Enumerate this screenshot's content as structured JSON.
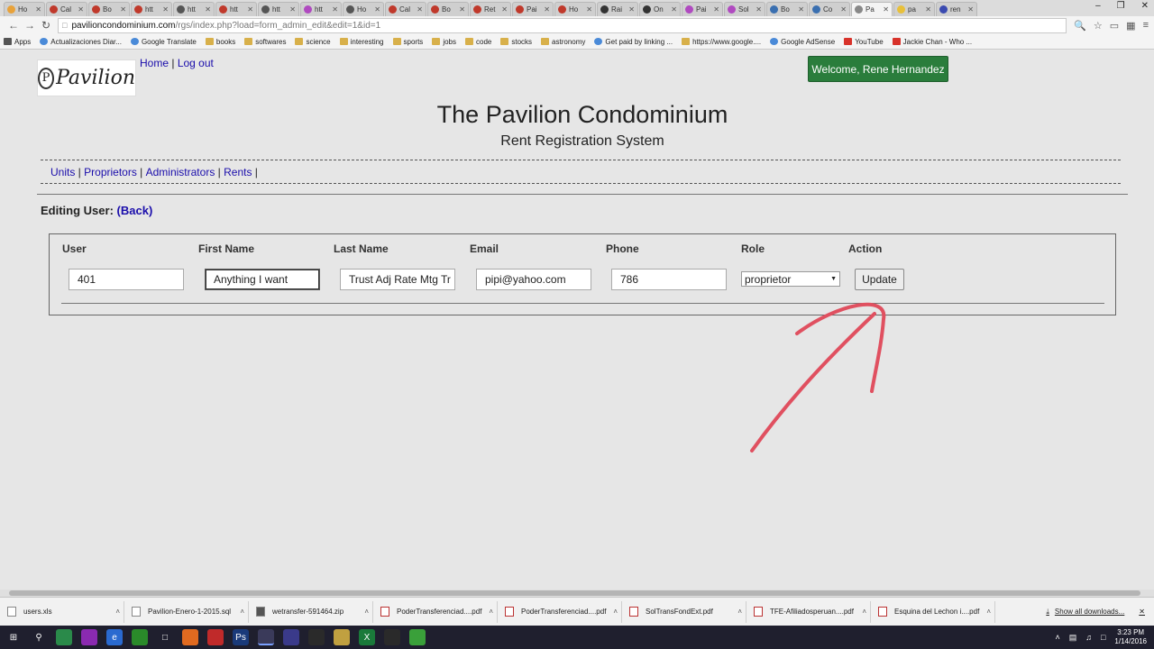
{
  "browser": {
    "tabs": [
      {
        "label": "Ho",
        "color": "#e8a23a"
      },
      {
        "label": "Cal",
        "color": "#c0392b"
      },
      {
        "label": "Bo",
        "color": "#c0392b"
      },
      {
        "label": "htt",
        "color": "#c0392b"
      },
      {
        "label": "htt",
        "color": "#555"
      },
      {
        "label": "htt",
        "color": "#c0392b"
      },
      {
        "label": "htt",
        "color": "#555"
      },
      {
        "label": "htt",
        "color": "#b04ac0"
      },
      {
        "label": "Ho",
        "color": "#555"
      },
      {
        "label": "Cal",
        "color": "#c0392b"
      },
      {
        "label": "Bo",
        "color": "#c0392b"
      },
      {
        "label": "Ret",
        "color": "#c0392b"
      },
      {
        "label": "Pai",
        "color": "#c0392b"
      },
      {
        "label": "Ho",
        "color": "#c0392b"
      },
      {
        "label": "Rai",
        "color": "#333"
      },
      {
        "label": "On",
        "color": "#333"
      },
      {
        "label": "Pai",
        "color": "#b04ac0"
      },
      {
        "label": "Sol",
        "color": "#b04ac0"
      },
      {
        "label": "Bo",
        "color": "#3a6fb0"
      },
      {
        "label": "Co",
        "color": "#3a6fb0"
      },
      {
        "label": "Pa",
        "color": "#888"
      },
      {
        "label": "pa",
        "color": "#e8c03a"
      },
      {
        "label": "ren",
        "color": "#3a4ab0"
      }
    ],
    "active_tab_index": 20,
    "url_host": "pavilioncondominium.com",
    "url_path": "/rgs/index.php?load=form_admin_edit&edit=1&id=1",
    "bookmarks": [
      {
        "label": "Apps",
        "icon": "apps"
      },
      {
        "label": "Actualizaciones Diar...",
        "icon": "folder-blue"
      },
      {
        "label": "Google Translate",
        "icon": "translate"
      },
      {
        "label": "books",
        "icon": "folder"
      },
      {
        "label": "softwares",
        "icon": "folder"
      },
      {
        "label": "science",
        "icon": "folder"
      },
      {
        "label": "interesting",
        "icon": "folder"
      },
      {
        "label": "sports",
        "icon": "folder"
      },
      {
        "label": "jobs",
        "icon": "folder"
      },
      {
        "label": "code",
        "icon": "folder"
      },
      {
        "label": "stocks",
        "icon": "folder"
      },
      {
        "label": "astronomy",
        "icon": "folder"
      },
      {
        "label": "Get paid by linking ...",
        "icon": "g"
      },
      {
        "label": "https://www.google....",
        "icon": "folder"
      },
      {
        "label": "Google AdSense",
        "icon": "g"
      },
      {
        "label": "YouTube",
        "icon": "youtube"
      },
      {
        "label": "Jackie Chan - Who ...",
        "icon": "youtube"
      }
    ]
  },
  "header": {
    "logo_text": "Pavilion",
    "logo_letter": "P",
    "home_link": "Home",
    "separator": "|",
    "logout_link": "Log out",
    "welcome": "Welcome, Rene Hernandez",
    "title": "The Pavilion Condominium",
    "subtitle": "Rent Registration System"
  },
  "nav": [
    {
      "label": "Units"
    },
    {
      "label": "Proprietors"
    },
    {
      "label": "Administrators"
    },
    {
      "label": "Rents"
    }
  ],
  "nav_separator": " | ",
  "editing": {
    "label": "Editing User:",
    "back_link": "(Back)"
  },
  "form": {
    "headers": {
      "user": "User",
      "first_name": "First Name",
      "last_name": "Last Name",
      "email": "Email",
      "phone": "Phone",
      "role": "Role",
      "action": "Action"
    },
    "values": {
      "user": "401",
      "first_name": "Anything I want",
      "last_name": "Trust Adj Rate Mtg Tr",
      "email": "pipi@yahoo.com",
      "phone": "786",
      "role": "proprietor"
    },
    "update_button": "Update"
  },
  "annotation_color": "#e05060",
  "downloads": [
    {
      "name": "users.xls",
      "type": "xls"
    },
    {
      "name": "Pavilion-Enero-1-2015.sql",
      "type": "file"
    },
    {
      "name": "wetransfer-591464.zip",
      "type": "zip"
    },
    {
      "name": "PoderTransferenciad....pdf",
      "type": "pdf"
    },
    {
      "name": "PoderTransferenciad....pdf",
      "type": "pdf"
    },
    {
      "name": "SolTransFondExt.pdf",
      "type": "pdf"
    },
    {
      "name": "TFE-Afiliadosperuan....pdf",
      "type": "pdf"
    },
    {
      "name": "Esquina del Lechon i....pdf",
      "type": "pdf"
    }
  ],
  "show_all_downloads": "Show all downloads...",
  "taskbar": {
    "time": "3:23 PM",
    "date": "1/14/2016"
  }
}
